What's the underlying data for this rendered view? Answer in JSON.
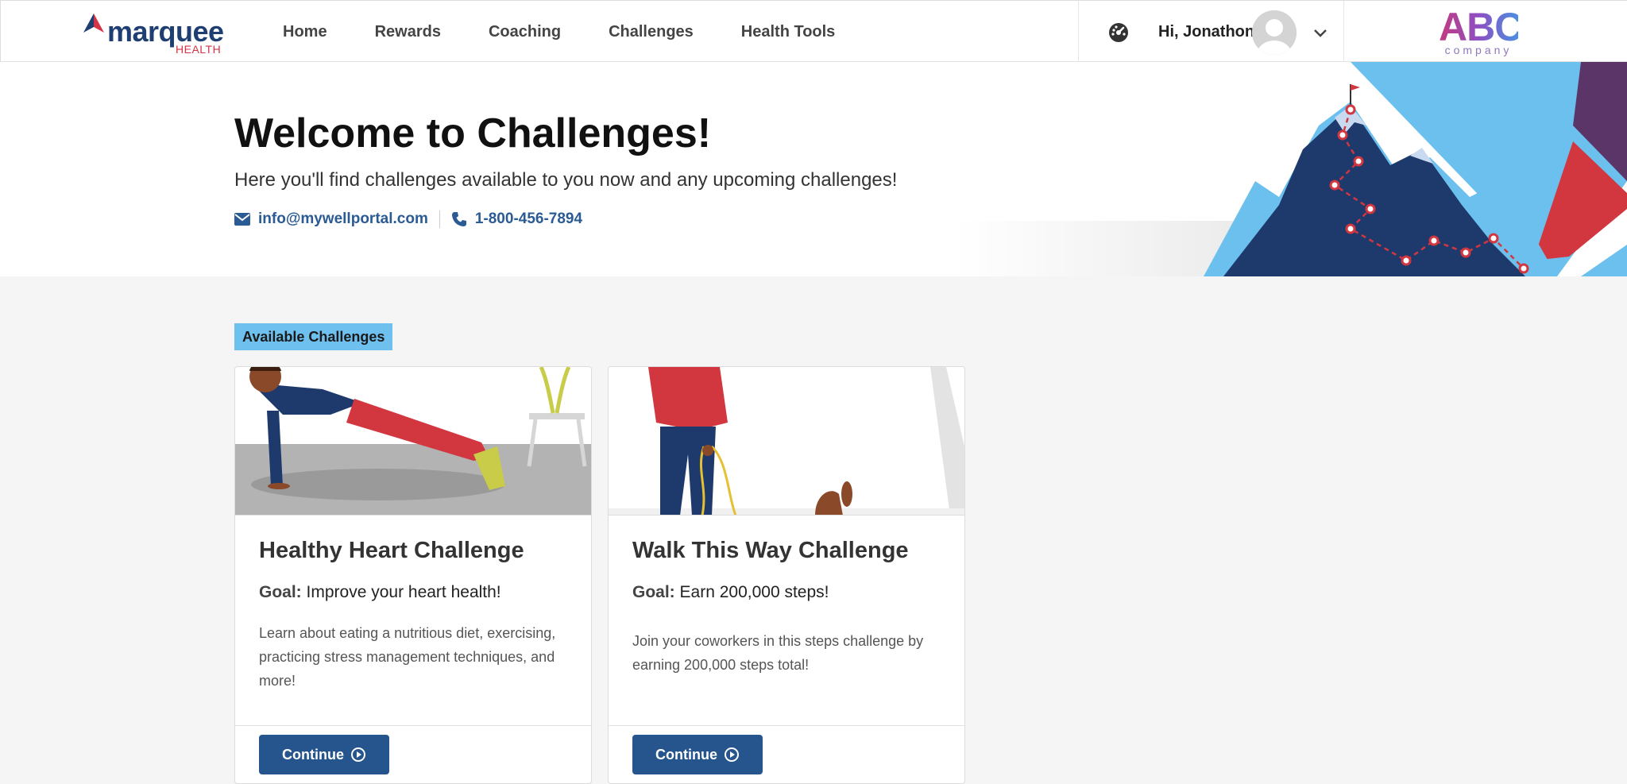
{
  "brand": {
    "name": "marquee",
    "sub": "HEALTH"
  },
  "nav": {
    "items": [
      "Home",
      "Rewards",
      "Coaching",
      "Challenges",
      "Health Tools"
    ]
  },
  "user": {
    "greeting": "Hi, Jonathon"
  },
  "partner": {
    "name": "ABC",
    "sub": "company"
  },
  "hero": {
    "title": "Welcome to Challenges!",
    "subtitle": "Here you'll find challenges available to you now and any upcoming challenges!",
    "email": "info@mywellportal.com",
    "phone": "1-800-456-7894"
  },
  "section": {
    "label": "Available Challenges"
  },
  "cards": [
    {
      "title": "Healthy Heart Challenge",
      "goal_label": "Goal:",
      "goal": "Improve your heart health!",
      "description": "Learn about eating a nutritious diet, exercising, practicing stress management techniques, and more!",
      "button": "Continue"
    },
    {
      "title": "Walk This Way Challenge",
      "goal_label": "Goal:",
      "goal": "Earn 200,000 steps!",
      "description": "Join your coworkers in this steps challenge by earning 200,000 steps total!",
      "button": "Continue"
    }
  ],
  "colors": {
    "primary": "#25558c",
    "accent": "#6ec0ee",
    "brand_red": "#d63346",
    "brand_navy": "#1f3f73"
  },
  "icons": [
    "dashboard-icon",
    "user-avatar-icon",
    "chevron-down-icon",
    "envelope-icon",
    "phone-icon",
    "play-circle-icon"
  ]
}
